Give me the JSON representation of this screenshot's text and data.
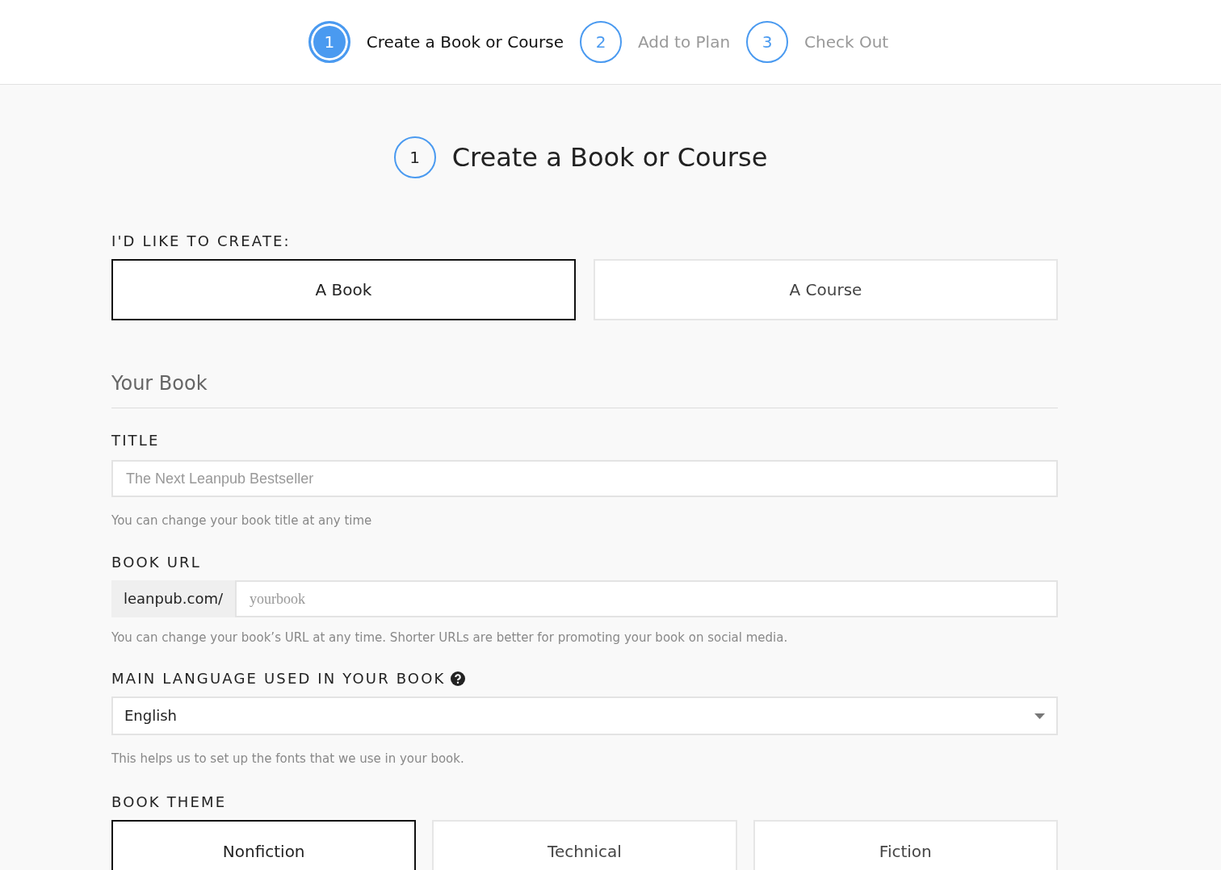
{
  "steps": [
    {
      "number": "1",
      "label": "Create a Book or Course",
      "selected": true
    },
    {
      "number": "2",
      "label": "Add to Plan",
      "selected": false
    },
    {
      "number": "3",
      "label": "Check Out",
      "selected": false
    }
  ],
  "heading": {
    "number": "1",
    "title": "Create a Book or Course"
  },
  "create_choice": {
    "label": "I'D LIKE TO CREATE:",
    "options": [
      {
        "label": "A Book",
        "selected": true
      },
      {
        "label": "A Course",
        "selected": false
      }
    ]
  },
  "section_title": "Your Book",
  "title_field": {
    "label": "TITLE",
    "placeholder": "The Next Leanpub Bestseller",
    "help": "You can change your book title at any time"
  },
  "url_field": {
    "label": "BOOK URL",
    "prefix": "leanpub.com/",
    "placeholder": "yourbook",
    "help": "You can change your book’s URL at any time. Shorter URLs are better for promoting your book on social media."
  },
  "language_field": {
    "label": "MAIN LANGUAGE USED IN YOUR BOOK",
    "value": "English",
    "help": "This helps us to set up the fonts that we use in your book."
  },
  "theme_choice": {
    "label": "BOOK THEME",
    "options": [
      {
        "label": "Nonfiction",
        "selected": true
      },
      {
        "label": "Technical",
        "selected": false
      },
      {
        "label": "Fiction",
        "selected": false
      }
    ]
  }
}
